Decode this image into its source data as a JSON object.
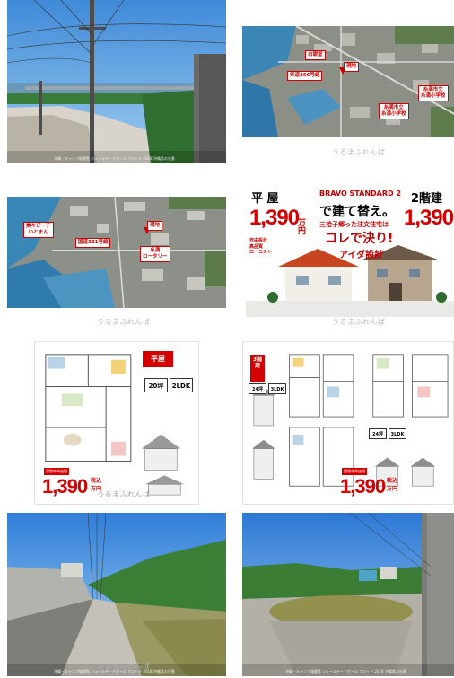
{
  "watermark": "うるまふれんぱ",
  "photos": [
    {
      "id": "view",
      "caption": "沖縄・キャンプ瑞慶覧 ジュールヤードボール フロード 2018 沖縄県の光景"
    },
    {
      "id": "map1",
      "labels": {
        "shirado": "白銀堂",
        "site": "現地",
        "route": "県道256号線",
        "elem": "糸満市立\n糸満小学校",
        "jhs": "糸満市立\n糸満小学校"
      }
    },
    {
      "id": "map2",
      "labels": {
        "beach": "美々ビーチ\nいとまん",
        "site": "現地",
        "route": "国道331号線",
        "rotary": "糸満\nロータリー"
      }
    },
    {
      "id": "ad",
      "left_tag": "平 屋",
      "right_tag": "2階建",
      "brand": "BRAVO STANDARD 2",
      "brand_sub": "ブラーボ・スタンダード2 平屋設計",
      "headline": "で建て替え。",
      "sub1": "三拾子郷った注文住宅は",
      "sub2": "コレで決り!",
      "company": "アイダ設計",
      "price": "1,390",
      "price_note": "税込",
      "price_unit": "万円",
      "badge_left": "自由設計\n高品質\nローコスト",
      "badge_right": "建物本体価格"
    },
    {
      "id": "plan1",
      "corner_tag": "平屋",
      "stat1": "20坪",
      "stat2": "2LDK",
      "price": "1,390",
      "price_unit": "万円",
      "price_note": "税込",
      "label": "建物本体価格"
    },
    {
      "id": "plan2",
      "corner_tag": "3階建",
      "stat1": "24坪",
      "stat2": "3LDK",
      "stat3": "24坪",
      "stat4": "3LDK",
      "price": "1,390",
      "price_unit": "万円",
      "price_note": "税込",
      "label": "建物本体価格"
    },
    {
      "id": "road",
      "caption": "沖縄・キャンプ瑞慶覧 ジュールヤードボール フロード 2018 沖縄県の光景"
    },
    {
      "id": "lot",
      "caption": "沖縄・キャンプ瑞慶覧 ジュールヤードボール フロード 2018 沖縄県の光景"
    }
  ]
}
